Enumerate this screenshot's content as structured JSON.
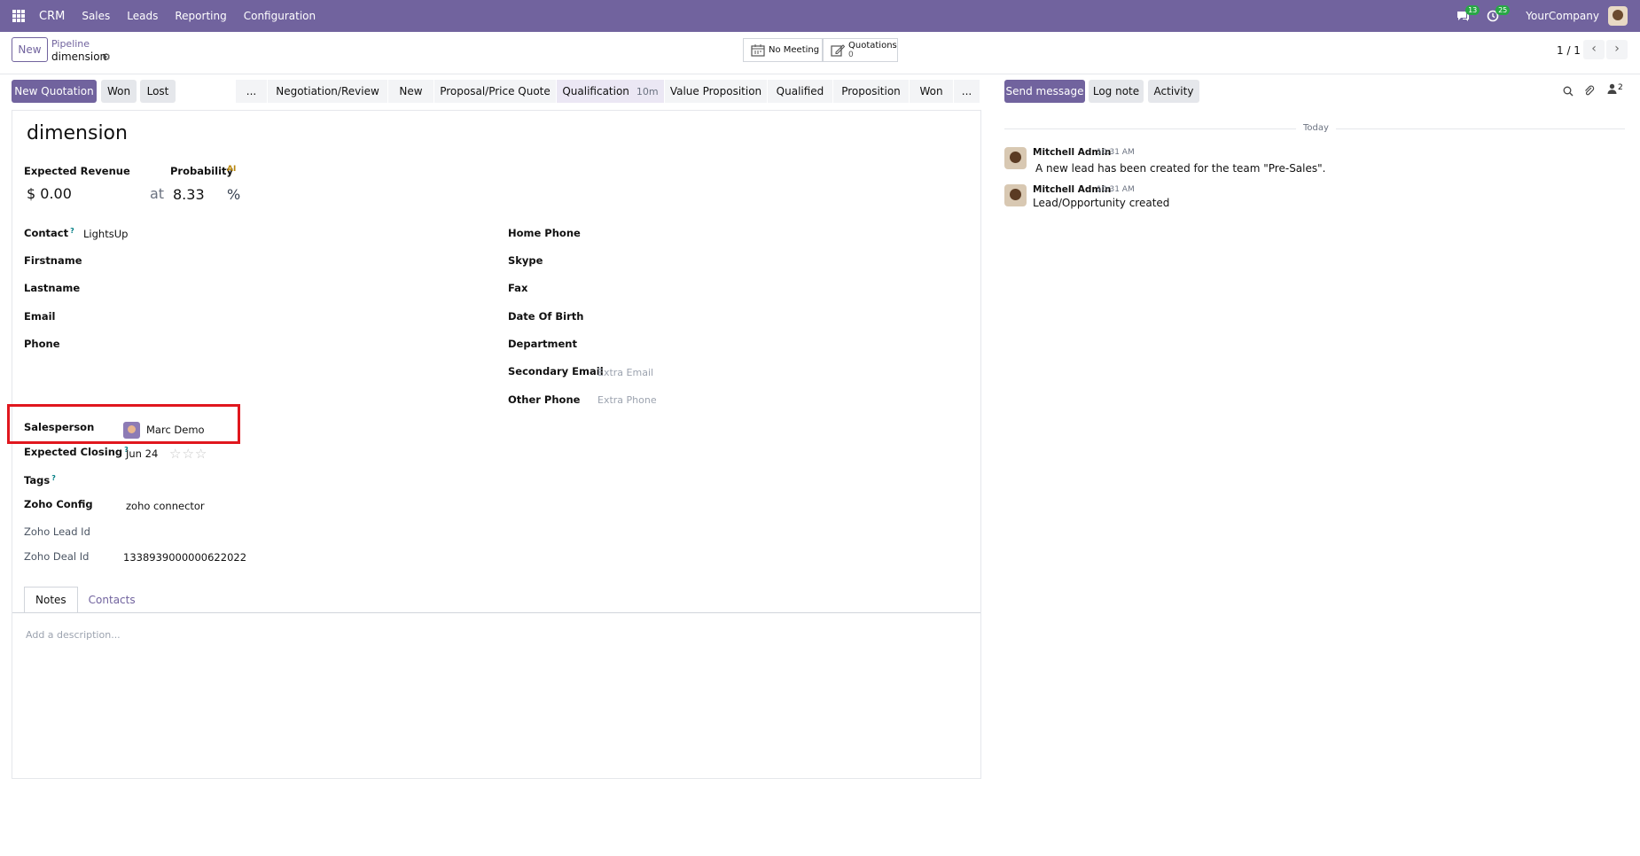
{
  "topbar": {
    "app": "CRM",
    "menu": [
      "Sales",
      "Leads",
      "Reporting",
      "Configuration"
    ],
    "messages_count": "13",
    "activities_count": "25",
    "company": "YourCompany"
  },
  "control": {
    "new_label": "New",
    "breadcrumb_parent": "Pipeline",
    "breadcrumb_current": "dimension",
    "meeting_label": "No Meeting",
    "quotations_label": "Quotations",
    "quotations_count": "0",
    "pager": "1 / 1"
  },
  "actions": {
    "new_quotation": "New Quotation",
    "won": "Won",
    "lost": "Lost"
  },
  "stages": [
    {
      "label": "..."
    },
    {
      "label": "Negotiation/Review"
    },
    {
      "label": "New"
    },
    {
      "label": "Proposal/Price Quote"
    },
    {
      "label": "Qualification",
      "time": "10m",
      "active": true
    },
    {
      "label": "Value Proposition"
    },
    {
      "label": "Qualified"
    },
    {
      "label": "Proposition"
    },
    {
      "label": "Won"
    },
    {
      "label": "..."
    }
  ],
  "form": {
    "title": "dimension",
    "expected_revenue_label": "Expected Revenue",
    "probability_label": "Probability",
    "ai_badge": "AI",
    "revenue_value": "$ 0.00",
    "at_label": "at",
    "probability_value": "8.33",
    "percent": "%",
    "contact_label": "Contact",
    "contact_value": "LightsUp",
    "firstname_label": "Firstname",
    "lastname_label": "Lastname",
    "email_label": "Email",
    "phone_label": "Phone",
    "home_phone_label": "Home Phone",
    "skype_label": "Skype",
    "fax_label": "Fax",
    "dob_label": "Date Of Birth",
    "department_label": "Department",
    "secondary_email_label": "Secondary Email",
    "secondary_email_placeholder": "Extra Email",
    "other_phone_label": "Other Phone",
    "other_phone_placeholder": "Extra Phone",
    "salesperson_label": "Salesperson",
    "salesperson_value": "Marc Demo",
    "expected_closing_label": "Expected Closing",
    "expected_closing_value": "Jun 24",
    "priority_stars": "☆☆☆",
    "tags_label": "Tags",
    "zoho_config_label": "Zoho Config",
    "zoho_config_value": "zoho connector",
    "zoho_lead_id_label": "Zoho Lead Id",
    "zoho_deal_id_label": "Zoho Deal Id",
    "zoho_deal_id_value": "1338939000000622022",
    "tabs": [
      "Notes",
      "Contacts"
    ],
    "description_placeholder": "Add a description..."
  },
  "chatter": {
    "send_message": "Send message",
    "log_note": "Log note",
    "activity": "Activity",
    "followers_count": "2",
    "day_label": "Today",
    "messages": [
      {
        "author": "Mitchell Admin",
        "time": "10:31 AM",
        "body": "A new lead has been created for the team \"Pre-Sales\"."
      },
      {
        "author": "Mitchell Admin",
        "time": "10:31 AM",
        "body": "Lead/Opportunity created"
      }
    ]
  },
  "colors": {
    "brand": "#71639e",
    "highlight": "#e0171e",
    "badge": "#28a745"
  }
}
